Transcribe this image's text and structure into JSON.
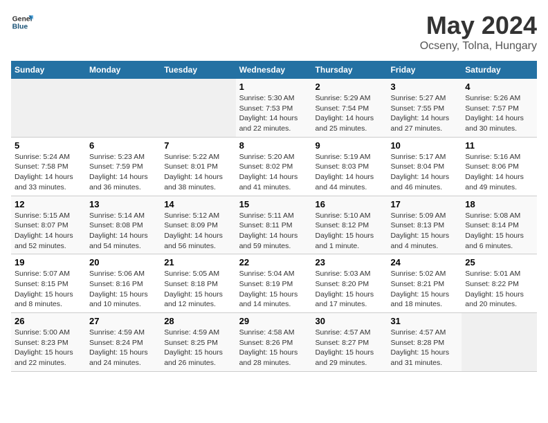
{
  "header": {
    "logo_general": "General",
    "logo_blue": "Blue",
    "title": "May 2024",
    "location": "Ocseny, Tolna, Hungary"
  },
  "weekdays": [
    "Sunday",
    "Monday",
    "Tuesday",
    "Wednesday",
    "Thursday",
    "Friday",
    "Saturday"
  ],
  "weeks": [
    [
      {
        "day": "",
        "info": ""
      },
      {
        "day": "",
        "info": ""
      },
      {
        "day": "",
        "info": ""
      },
      {
        "day": "1",
        "info": "Sunrise: 5:30 AM\nSunset: 7:53 PM\nDaylight: 14 hours\nand 22 minutes."
      },
      {
        "day": "2",
        "info": "Sunrise: 5:29 AM\nSunset: 7:54 PM\nDaylight: 14 hours\nand 25 minutes."
      },
      {
        "day": "3",
        "info": "Sunrise: 5:27 AM\nSunset: 7:55 PM\nDaylight: 14 hours\nand 27 minutes."
      },
      {
        "day": "4",
        "info": "Sunrise: 5:26 AM\nSunset: 7:57 PM\nDaylight: 14 hours\nand 30 minutes."
      }
    ],
    [
      {
        "day": "5",
        "info": "Sunrise: 5:24 AM\nSunset: 7:58 PM\nDaylight: 14 hours\nand 33 minutes."
      },
      {
        "day": "6",
        "info": "Sunrise: 5:23 AM\nSunset: 7:59 PM\nDaylight: 14 hours\nand 36 minutes."
      },
      {
        "day": "7",
        "info": "Sunrise: 5:22 AM\nSunset: 8:01 PM\nDaylight: 14 hours\nand 38 minutes."
      },
      {
        "day": "8",
        "info": "Sunrise: 5:20 AM\nSunset: 8:02 PM\nDaylight: 14 hours\nand 41 minutes."
      },
      {
        "day": "9",
        "info": "Sunrise: 5:19 AM\nSunset: 8:03 PM\nDaylight: 14 hours\nand 44 minutes."
      },
      {
        "day": "10",
        "info": "Sunrise: 5:17 AM\nSunset: 8:04 PM\nDaylight: 14 hours\nand 46 minutes."
      },
      {
        "day": "11",
        "info": "Sunrise: 5:16 AM\nSunset: 8:06 PM\nDaylight: 14 hours\nand 49 minutes."
      }
    ],
    [
      {
        "day": "12",
        "info": "Sunrise: 5:15 AM\nSunset: 8:07 PM\nDaylight: 14 hours\nand 52 minutes."
      },
      {
        "day": "13",
        "info": "Sunrise: 5:14 AM\nSunset: 8:08 PM\nDaylight: 14 hours\nand 54 minutes."
      },
      {
        "day": "14",
        "info": "Sunrise: 5:12 AM\nSunset: 8:09 PM\nDaylight: 14 hours\nand 56 minutes."
      },
      {
        "day": "15",
        "info": "Sunrise: 5:11 AM\nSunset: 8:11 PM\nDaylight: 14 hours\nand 59 minutes."
      },
      {
        "day": "16",
        "info": "Sunrise: 5:10 AM\nSunset: 8:12 PM\nDaylight: 15 hours\nand 1 minute."
      },
      {
        "day": "17",
        "info": "Sunrise: 5:09 AM\nSunset: 8:13 PM\nDaylight: 15 hours\nand 4 minutes."
      },
      {
        "day": "18",
        "info": "Sunrise: 5:08 AM\nSunset: 8:14 PM\nDaylight: 15 hours\nand 6 minutes."
      }
    ],
    [
      {
        "day": "19",
        "info": "Sunrise: 5:07 AM\nSunset: 8:15 PM\nDaylight: 15 hours\nand 8 minutes."
      },
      {
        "day": "20",
        "info": "Sunrise: 5:06 AM\nSunset: 8:16 PM\nDaylight: 15 hours\nand 10 minutes."
      },
      {
        "day": "21",
        "info": "Sunrise: 5:05 AM\nSunset: 8:18 PM\nDaylight: 15 hours\nand 12 minutes."
      },
      {
        "day": "22",
        "info": "Sunrise: 5:04 AM\nSunset: 8:19 PM\nDaylight: 15 hours\nand 14 minutes."
      },
      {
        "day": "23",
        "info": "Sunrise: 5:03 AM\nSunset: 8:20 PM\nDaylight: 15 hours\nand 17 minutes."
      },
      {
        "day": "24",
        "info": "Sunrise: 5:02 AM\nSunset: 8:21 PM\nDaylight: 15 hours\nand 18 minutes."
      },
      {
        "day": "25",
        "info": "Sunrise: 5:01 AM\nSunset: 8:22 PM\nDaylight: 15 hours\nand 20 minutes."
      }
    ],
    [
      {
        "day": "26",
        "info": "Sunrise: 5:00 AM\nSunset: 8:23 PM\nDaylight: 15 hours\nand 22 minutes."
      },
      {
        "day": "27",
        "info": "Sunrise: 4:59 AM\nSunset: 8:24 PM\nDaylight: 15 hours\nand 24 minutes."
      },
      {
        "day": "28",
        "info": "Sunrise: 4:59 AM\nSunset: 8:25 PM\nDaylight: 15 hours\nand 26 minutes."
      },
      {
        "day": "29",
        "info": "Sunrise: 4:58 AM\nSunset: 8:26 PM\nDaylight: 15 hours\nand 28 minutes."
      },
      {
        "day": "30",
        "info": "Sunrise: 4:57 AM\nSunset: 8:27 PM\nDaylight: 15 hours\nand 29 minutes."
      },
      {
        "day": "31",
        "info": "Sunrise: 4:57 AM\nSunset: 8:28 PM\nDaylight: 15 hours\nand 31 minutes."
      },
      {
        "day": "",
        "info": ""
      }
    ]
  ]
}
